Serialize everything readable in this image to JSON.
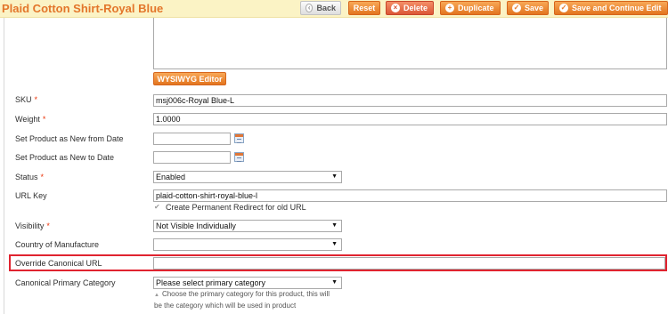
{
  "header": {
    "title": "Plaid Cotton Shirt-Royal Blue",
    "buttons": {
      "back": "Back",
      "reset": "Reset",
      "delete": "Delete",
      "duplicate": "Duplicate",
      "save": "Save",
      "save_continue": "Save and Continue Edit"
    }
  },
  "editor": {
    "wysiwyg_label": "WYSIWYG Editor"
  },
  "fields": {
    "sku": {
      "label": "SKU",
      "value": "msj006c-Royal Blue-L"
    },
    "weight": {
      "label": "Weight",
      "value": "1.0000"
    },
    "new_from": {
      "label": "Set Product as New from Date",
      "value": ""
    },
    "new_to": {
      "label": "Set Product as New to Date",
      "value": ""
    },
    "status": {
      "label": "Status",
      "value": "Enabled"
    },
    "url_key": {
      "label": "URL Key",
      "value": "plaid-cotton-shirt-royal-blue-l",
      "redirect_label": "Create Permanent Redirect for old URL"
    },
    "visibility": {
      "label": "Visibility",
      "value": "Not Visible Individually"
    },
    "country": {
      "label": "Country of Manufacture",
      "value": ""
    },
    "canonical_url": {
      "label": "Override Canonical URL",
      "value": ""
    },
    "primary_category": {
      "label": "Canonical Primary Category",
      "value": "Please select primary category",
      "note_line1": "Choose the primary category for this product, this will",
      "note_line2": "be the category which will be used in product"
    }
  },
  "required_marker": "*",
  "colors": {
    "accent": "#e3762b",
    "header_bg": "#fbf3c5",
    "highlight": "#e0232f",
    "required": "#eb340a"
  }
}
